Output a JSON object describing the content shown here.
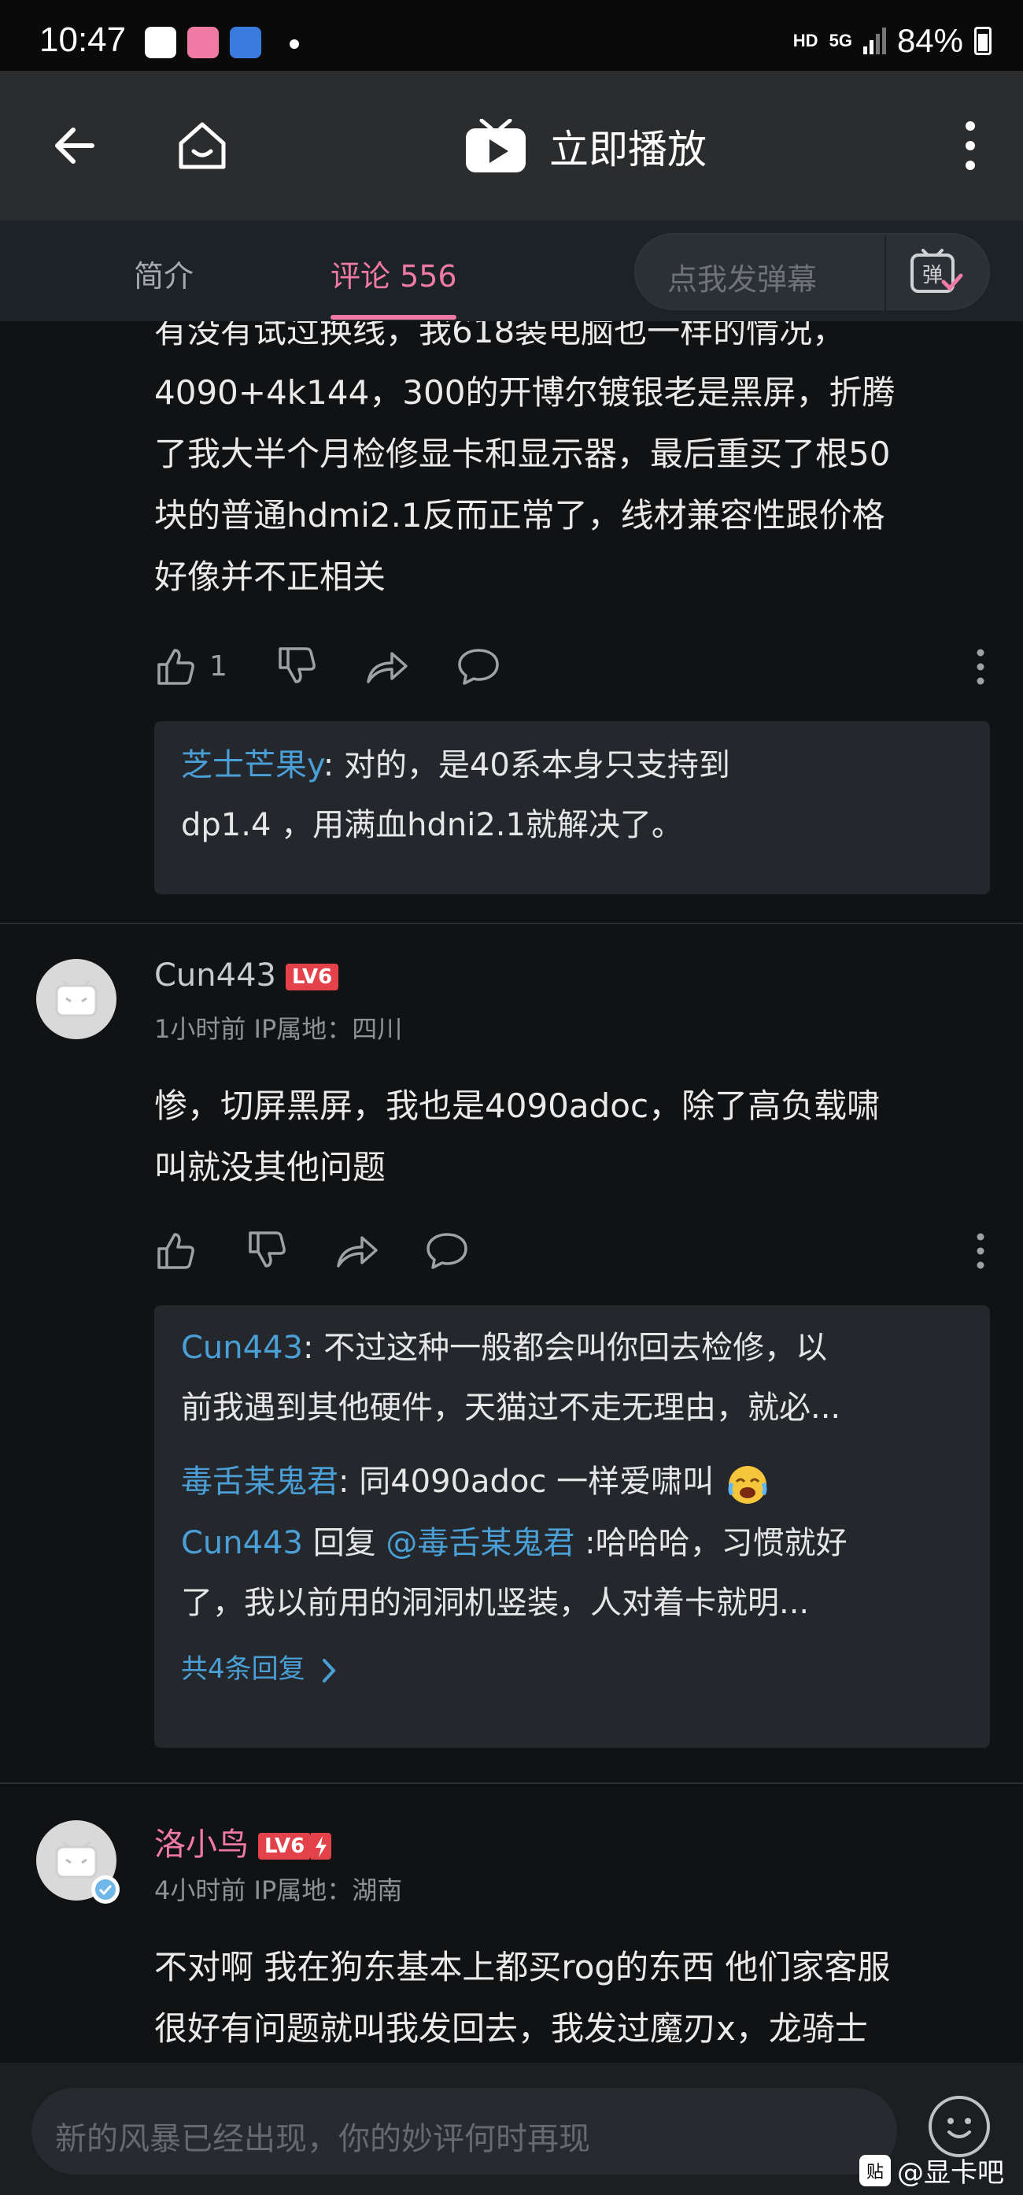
{
  "status_bar": {
    "time": "10:47",
    "network": "HD",
    "network_type": "5G",
    "battery": "84%"
  },
  "nav": {
    "title": "立即播放"
  },
  "tabs": {
    "intro": "简介",
    "comments": "评论 556"
  },
  "danmu": {
    "placeholder": "点我发弹幕",
    "icon_label": "弹"
  },
  "comment1": {
    "lines": [
      "有没有试过换线，我618装电脑也一样的情况，",
      "4090+4k144，300的开博尔镀银老是黑屏，折腾",
      "了我大半个月检修显卡和显示器，最后重买了根50",
      "块的普通hdmi2.1反而正常了，线材兼容性跟价格",
      "好像并不正相关"
    ],
    "likes": "1",
    "reply": {
      "user": "芝士芒果y",
      "text_line1": ": 对的，是40系本身只支持到",
      "text_line2": "dp1.4 ，用满血hdni2.1就解决了。"
    }
  },
  "comment2": {
    "username": "Cun443",
    "level": "LV6",
    "meta": "1小时前  IP属地：四川",
    "lines": [
      "惨，切屏黑屏，我也是4090adoc，除了高负载啸",
      "叫就没其他问题"
    ],
    "replies": {
      "r1_user": "Cun443",
      "r1_line1": ": 不过这种一般都会叫你回去检修，以",
      "r1_line2": "前我遇到其他硬件，天猫过不走无理由，就必...",
      "r2_user": "毒舌某鬼君",
      "r2_text": ": 同4090adoc 一样爱啸叫",
      "r3_user": "Cun443",
      "r3_mid": " 回复 ",
      "r3_mention": "@毒舌某鬼君",
      "r3_line1": " :哈哈哈，习惯就好",
      "r3_line2": "了，我以前用的洞洞机竖装，人对着卡就明...",
      "more": "共4条回复"
    }
  },
  "comment3": {
    "username": "洛小鸟",
    "level": "LV6",
    "meta": "4小时前  IP属地：湖南",
    "lines": [
      "不对啊 我在狗东基本上都买rog的东西 他们家客服",
      "很好有问题就叫我发回去，我发过魔刃x，龙骑士"
    ]
  },
  "bottom": {
    "input_placeholder": "新的风暴已经出现，你的妙评何时再现",
    "watermark": "@显卡吧",
    "watermark_badge": "贴"
  },
  "colors": {
    "accent_pink": "#f07aa3",
    "link_blue": "#4a9fd6",
    "level_red": "#e4424a",
    "bg": "#111214"
  }
}
